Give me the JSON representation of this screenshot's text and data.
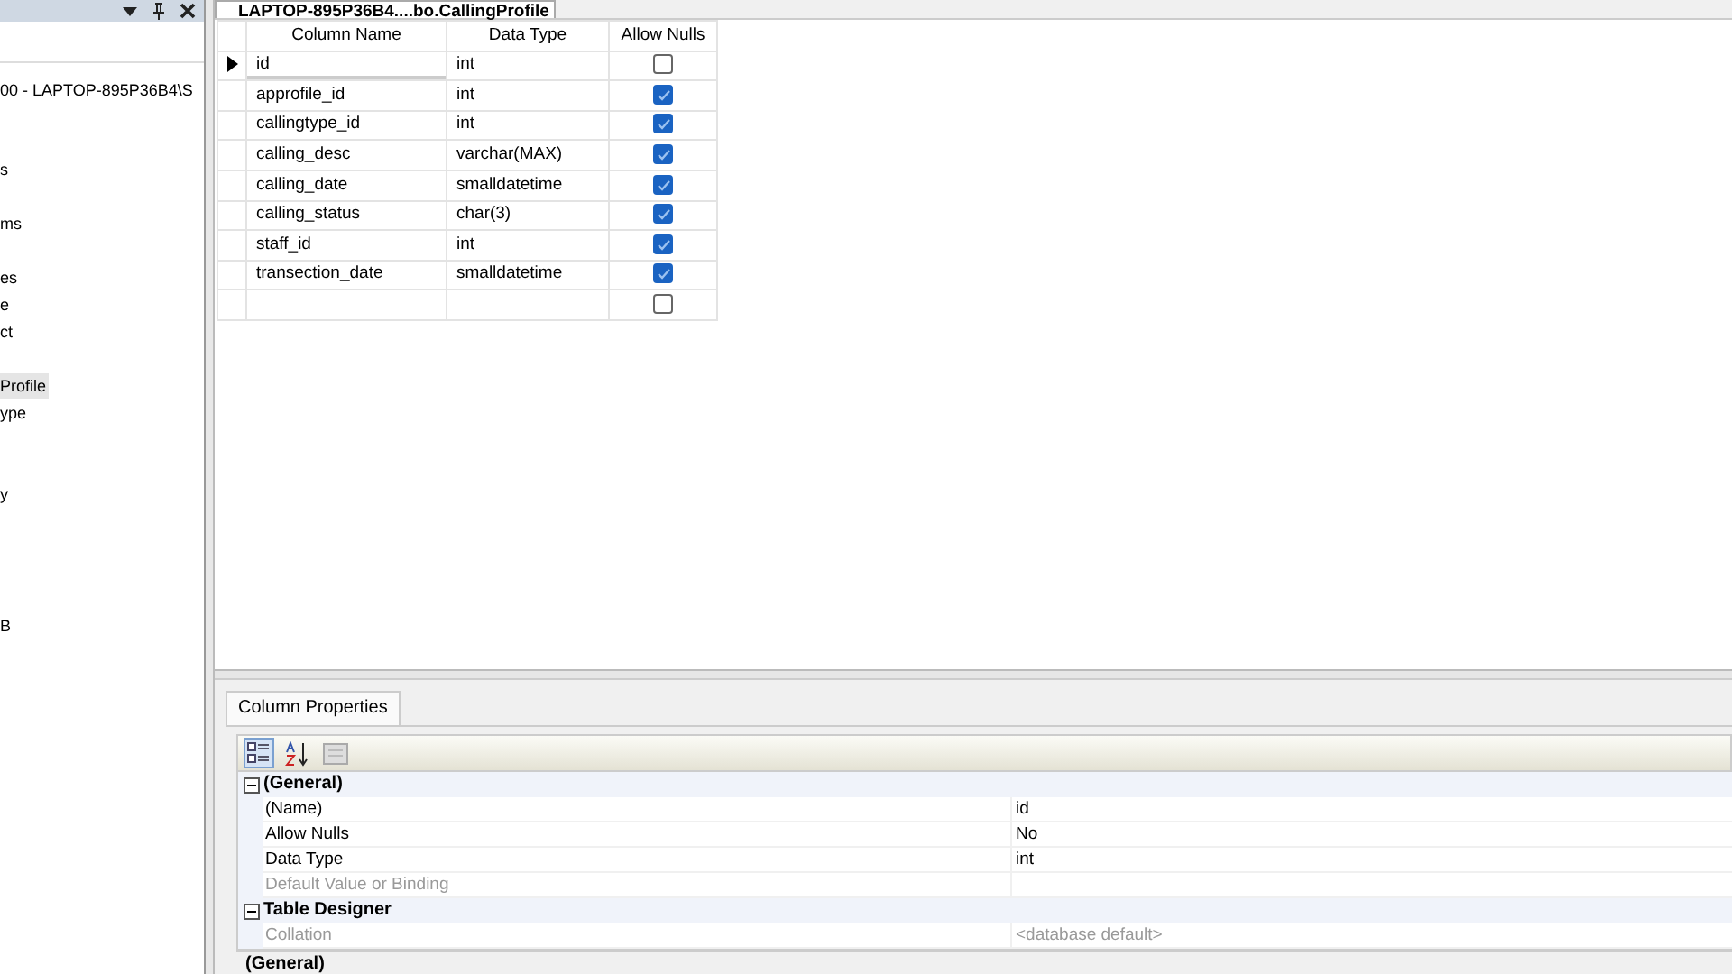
{
  "explorer": {
    "tools": [
      {
        "kind": "dropdown"
      },
      {
        "kind": "pin"
      },
      {
        "kind": "close"
      }
    ],
    "items": [
      {
        "label": "00 - LAPTOP-895P36B4\\S",
        "selected": false
      },
      {
        "label": "s",
        "selected": false
      },
      {
        "label": "ms",
        "selected": false
      },
      {
        "label": "es",
        "selected": false
      },
      {
        "label": "e",
        "selected": false
      },
      {
        "label": "ct",
        "selected": false
      },
      {
        "label": "Profile",
        "selected": true
      },
      {
        "label": "ype",
        "selected": false
      },
      {
        "label": "y",
        "selected": false
      },
      {
        "label": "B",
        "selected": false
      }
    ]
  },
  "document_tab": {
    "title": "LAPTOP-895P36B4....bo.CallingProfile",
    "selected": true
  },
  "table": {
    "columns": [
      "Column Name",
      "Data Type",
      "Allow Nulls"
    ],
    "rows": [
      {
        "name": "id",
        "type": "int",
        "allow_nulls": false,
        "selected": true
      },
      {
        "name": "approfile_id",
        "type": "int",
        "allow_nulls": true,
        "selected": false
      },
      {
        "name": "callingtype_id",
        "type": "int",
        "allow_nulls": true,
        "selected": false
      },
      {
        "name": "calling_desc",
        "type": "varchar(MAX)",
        "allow_nulls": true,
        "selected": false
      },
      {
        "name": "calling_date",
        "type": "smalldatetime",
        "allow_nulls": true,
        "selected": false
      },
      {
        "name": "calling_status",
        "type": "char(3)",
        "allow_nulls": true,
        "selected": false
      },
      {
        "name": "staff_id",
        "type": "int",
        "allow_nulls": true,
        "selected": false
      },
      {
        "name": "transection_date",
        "type": "smalldatetime",
        "allow_nulls": true,
        "selected": false
      },
      {
        "allow_nulls": false,
        "selected": false
      }
    ]
  },
  "properties": {
    "tab": "Column Properties",
    "toolbar": [
      {
        "kind": "categorized",
        "selected": true
      },
      {
        "kind": "alphabetical",
        "selected": false
      },
      {
        "kind": "pages",
        "selected": false
      }
    ],
    "rows": [
      {
        "kind": "category",
        "label": "(General)",
        "expanded": true
      },
      {
        "kind": "property",
        "label": "(Name)",
        "value": "id",
        "disabled": false
      },
      {
        "kind": "property",
        "label": "Allow Nulls",
        "value": "No",
        "disabled": false
      },
      {
        "kind": "property",
        "label": "Data Type",
        "value": "int",
        "disabled": false
      },
      {
        "kind": "property",
        "label": "Default Value or Binding",
        "disabled": true
      },
      {
        "kind": "category",
        "label": "Table Designer",
        "expanded": true
      },
      {
        "kind": "property",
        "label": "Collation",
        "value": "<database default>",
        "disabled": true
      }
    ],
    "description": "(General)"
  }
}
